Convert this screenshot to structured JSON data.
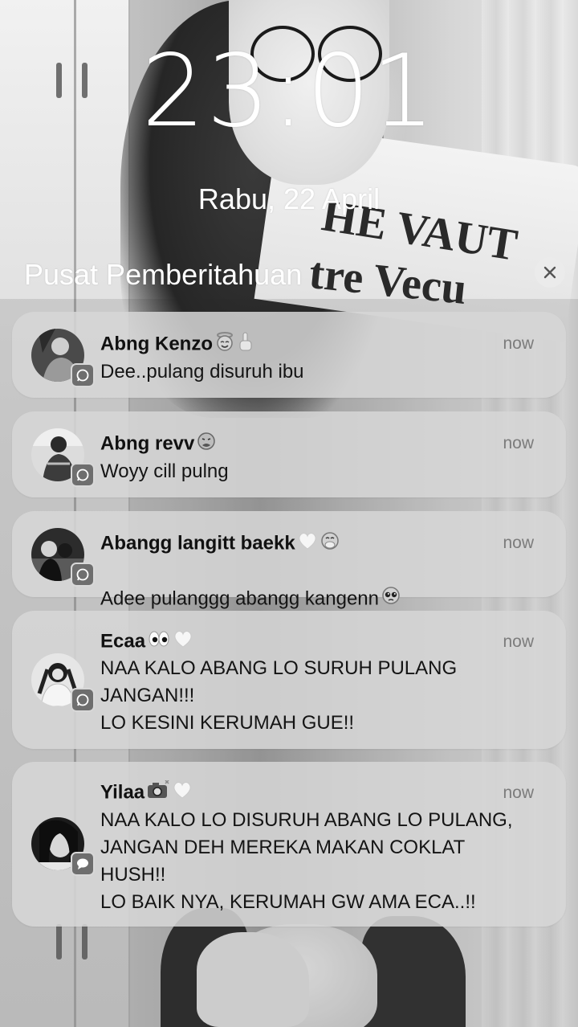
{
  "lockscreen": {
    "time": "23:01",
    "date": "Rabu, 22 April",
    "notification_center_title": "Pusat Pemberitahuan"
  },
  "notifications": [
    {
      "sender": "Abng Kenzo",
      "emoji_icons": [
        "smiling-face-with-halo-emoji",
        "hand-gesture-emoji"
      ],
      "time": "now",
      "message": "Dee..pulang disuruh ibu",
      "app_icon": "whatsapp-icon"
    },
    {
      "sender": "Abng revv",
      "emoji_icons": [
        "nauseated-face-emoji"
      ],
      "time": "now",
      "message": "Woyy cill pulng",
      "app_icon": "whatsapp-icon"
    },
    {
      "sender": "Abangg langitt baekk",
      "emoji_icons": [
        "white-heart-emoji",
        "face-with-hand-over-mouth-emoji"
      ],
      "time": "now",
      "message": "Adee pulanggg abangg kangenn",
      "message_emoji_icon": "pleading-face-emoji",
      "app_icon": "whatsapp-icon"
    },
    {
      "sender": "Ecaa",
      "emoji_icons": [
        "eyes-emoji",
        "white-heart-emoji"
      ],
      "time": "now",
      "message": "NAA KALO ABANG LO SURUH PULANG JANGAN!!!\nLO KESINI KERUMAH GUE!!",
      "app_icon": "whatsapp-icon"
    },
    {
      "sender": "Yilaa",
      "emoji_icons": [
        "camera-with-flash-emoji",
        "white-heart-emoji"
      ],
      "time": "now",
      "message": "NAA KALO LO DISURUH ABANG LO PULANG, JANGAN DEH MEREKA MAKAN COKLAT HUSH!!\nLO BAIK NYA, KERUMAH GW AMA ECA..!!",
      "app_icon": "messages-icon"
    }
  ]
}
